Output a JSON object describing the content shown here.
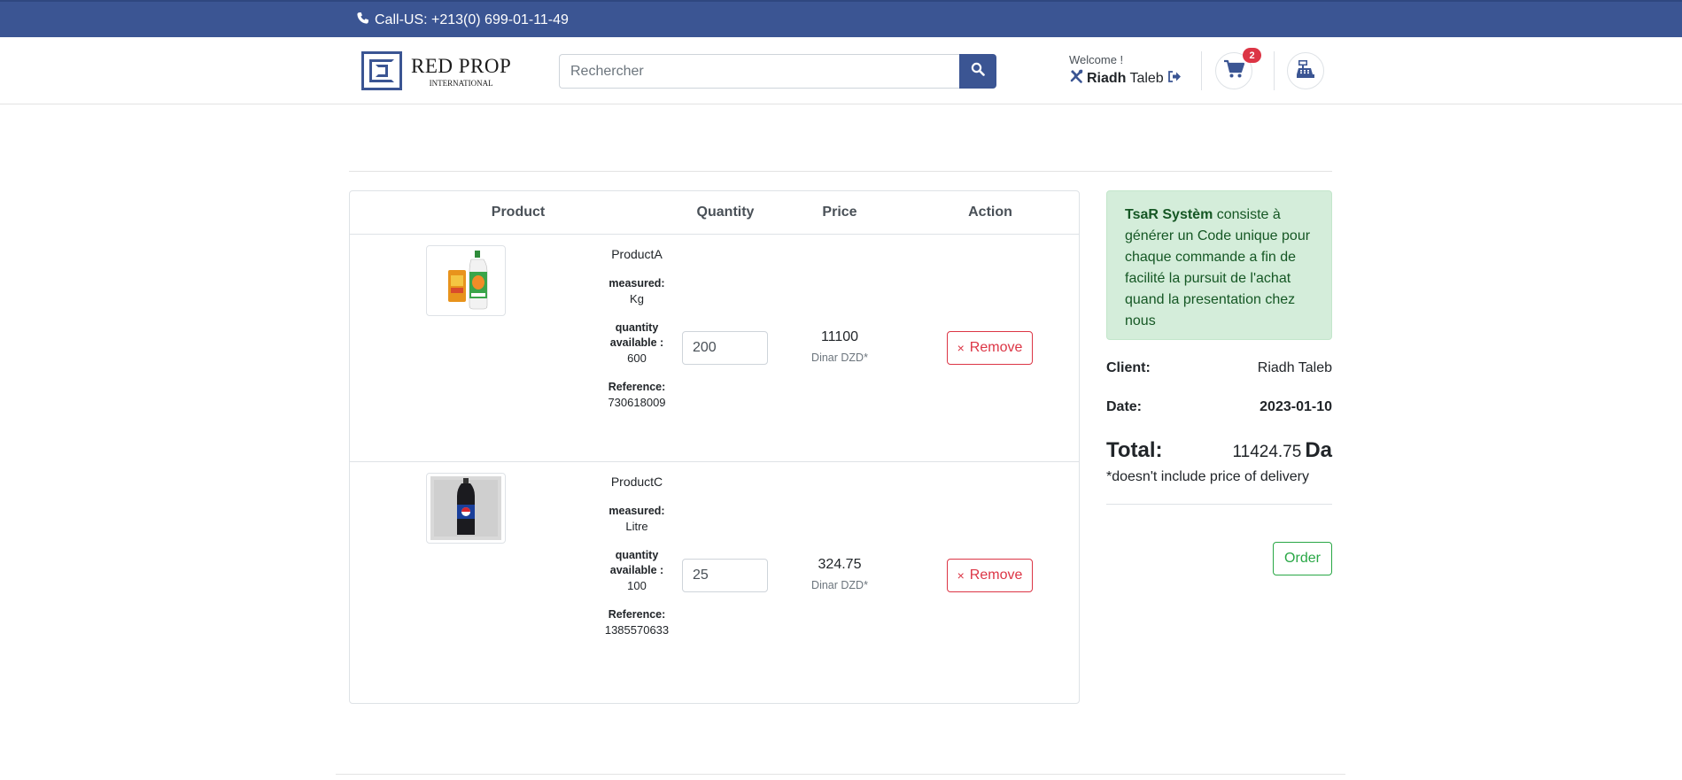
{
  "topbar": {
    "call_text": "Call-US: +213(0) 699-01-11-49",
    "background": "#3b5593"
  },
  "logo": {
    "name": "RED PROP",
    "subtitle": "INTERNATIONAL"
  },
  "search": {
    "placeholder": "Rechercher"
  },
  "user": {
    "welcome": "Welcome !",
    "first_name": "Riadh",
    "last_name": "Taleb"
  },
  "cart_badge": "2",
  "table": {
    "headers": {
      "product": "Product",
      "quantity": "Quantity",
      "price": "Price",
      "action": "Action"
    },
    "rows": [
      {
        "name": "ProductA",
        "measured_label": "measured:",
        "measured": "Kg",
        "available_label": "quantity available :",
        "available": "600",
        "reference_label": "Reference:",
        "reference": "730618009",
        "quantity": "200",
        "price": "11100",
        "currency": "Dinar DZD*",
        "remove_label": "Remove"
      },
      {
        "name": "ProductC",
        "measured_label": "measured:",
        "measured": "Litre",
        "available_label": "quantity available :",
        "available": "100",
        "reference_label": "Reference:",
        "reference": "1385570633",
        "quantity": "25",
        "price": "324.75",
        "currency": "Dinar DZD*",
        "remove_label": "Remove"
      }
    ]
  },
  "summary": {
    "alert_strong": "TsaR Systèm",
    "alert_text": " consiste à générer un Code unique pour chaque commande a fin de facilité la pursuit de l'achat quand la presentation chez nous",
    "client_label": "Client:",
    "client_value": "Riadh Taleb",
    "date_label": "Date:",
    "date_value": "2023-01-10",
    "total_label": "Total:",
    "total_value": "11424.75",
    "total_unit": "Da",
    "note": "*doesn't include price of delivery",
    "order_label": "Order"
  },
  "colors": {
    "accent": "#3b5593",
    "danger": "#dc3545",
    "success": "#28a745",
    "alert_bg": "#d4edda"
  }
}
